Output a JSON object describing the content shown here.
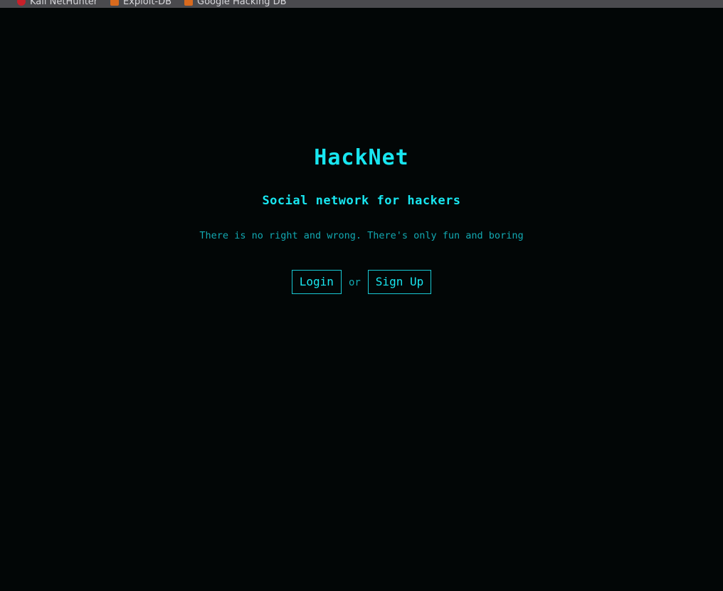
{
  "bookmarks": {
    "items": [
      {
        "label": "Kali NetHunter",
        "icon": "kali-dragon-icon"
      },
      {
        "label": "Exploit-DB",
        "icon": "exploit-db-icon"
      },
      {
        "label": "Google Hacking DB",
        "icon": "ghdb-icon"
      }
    ]
  },
  "page": {
    "title": "HackNet",
    "subtitle": "Social network for hackers",
    "tagline": "There is no right and wrong. There's only fun and boring",
    "login_label": "Login",
    "separator": "or",
    "signup_label": "Sign Up"
  },
  "colors": {
    "background": "#020606",
    "accent": "#18e6f0",
    "muted": "#12a9b2"
  }
}
